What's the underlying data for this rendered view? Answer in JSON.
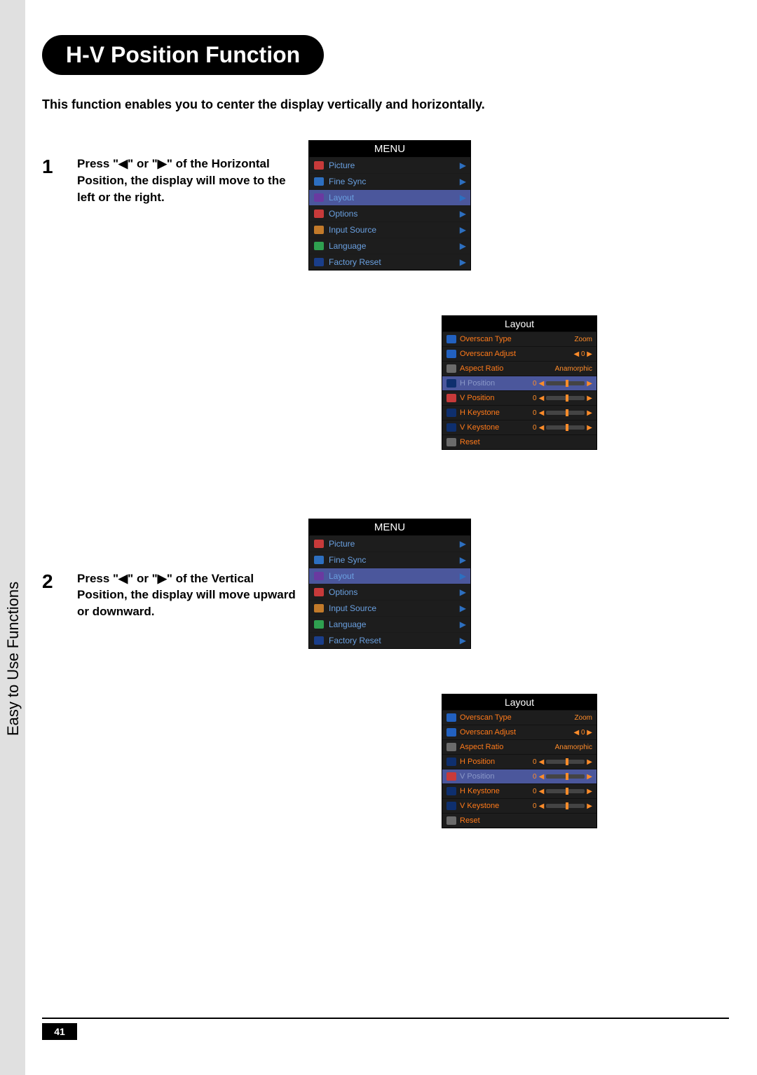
{
  "sidebar": {
    "label": "Easy to Use Functions"
  },
  "header": {
    "title": "H-V Position Function"
  },
  "intro": "This function enables you to center the display vertically and horizontally.",
  "steps": {
    "s1": {
      "num": "1",
      "text": "Press \"◀\" or \"▶\" of the Horizontal Position, the display will move to the left or the right."
    },
    "s2": {
      "num": "2",
      "text": "Press \"◀\" or \"▶\" of the Vertical Position, the display will move upward or downward."
    }
  },
  "menu": {
    "title": "MENU",
    "items": [
      {
        "label": "Picture"
      },
      {
        "label": "Fine Sync"
      },
      {
        "label": "Layout",
        "highlight": true
      },
      {
        "label": "Options"
      },
      {
        "label": "Input Source"
      },
      {
        "label": "Language"
      },
      {
        "label": "Factory Reset"
      }
    ]
  },
  "layout1": {
    "title": "Layout",
    "rows": [
      {
        "label": "Overscan Type",
        "value": "Zoom"
      },
      {
        "label": "Overscan Adjust",
        "value": "◀ 0 ▶"
      },
      {
        "label": "Aspect Ratio",
        "value": "Anamorphic"
      },
      {
        "label": "H Position",
        "value": "0",
        "slider": true,
        "highlight": true
      },
      {
        "label": "V Position",
        "value": "0",
        "slider": true
      },
      {
        "label": "H Keystone",
        "value": "0",
        "slider": true
      },
      {
        "label": "V Keystone",
        "value": "0",
        "slider": true
      },
      {
        "label": "Reset"
      }
    ]
  },
  "layout2": {
    "title": "Layout",
    "rows": [
      {
        "label": "Overscan Type",
        "value": "Zoom"
      },
      {
        "label": "Overscan Adjust",
        "value": "◀ 0 ▶"
      },
      {
        "label": "Aspect Ratio",
        "value": "Anamorphic"
      },
      {
        "label": "H Position",
        "value": "0",
        "slider": true
      },
      {
        "label": "V Position",
        "value": "0",
        "slider": true,
        "highlight": true
      },
      {
        "label": "H Keystone",
        "value": "0",
        "slider": true
      },
      {
        "label": "V Keystone",
        "value": "0",
        "slider": true
      },
      {
        "label": "Reset"
      }
    ]
  },
  "footer": {
    "page": "41"
  }
}
